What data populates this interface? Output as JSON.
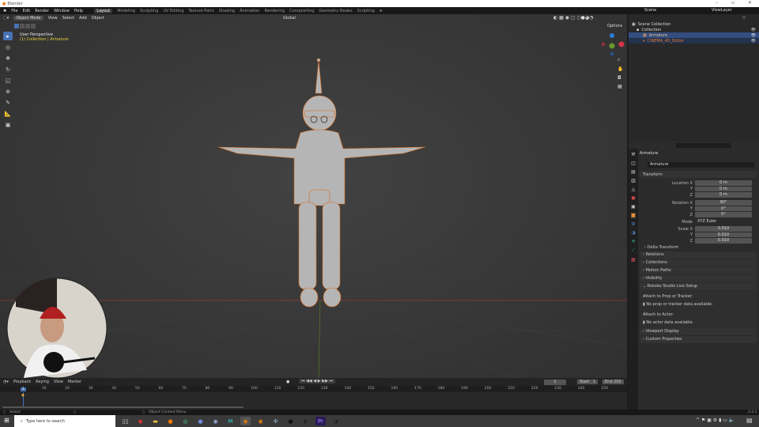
{
  "window": {
    "title": "Blender"
  },
  "menus": [
    "File",
    "Edit",
    "Render",
    "Window",
    "Help"
  ],
  "workspaces": [
    "Layout",
    "Modeling",
    "Sculpting",
    "UV Editing",
    "Texture Paint",
    "Shading",
    "Animation",
    "Rendering",
    "Compositing",
    "Geometry Nodes",
    "Scripting"
  ],
  "active_workspace": "Layout",
  "scene": "Scene",
  "view_layer": "ViewLayer",
  "viewport": {
    "mode": "Object Mode",
    "menus": [
      "View",
      "Select",
      "Add",
      "Object"
    ],
    "orientation": "Global",
    "options": "Options",
    "perspective": "User Perspective",
    "context": "(1) Collection | Armature"
  },
  "outliner": {
    "root": "Scene Collection",
    "collection": "Collection",
    "items": [
      "Armature",
      "CINEMA_4D_Editor"
    ]
  },
  "properties": {
    "object": "Armature",
    "data_name": "Armature",
    "transform": "Transform",
    "location": {
      "label": "Location X",
      "x": "0 m",
      "y": "0 m",
      "z": "0 m"
    },
    "rotation": {
      "label": "Rotation X",
      "x": "90°",
      "y": "0°",
      "z": "0°"
    },
    "mode_label": "Mode",
    "mode": "XYZ Euler",
    "scale": {
      "label": "Scale X",
      "x": "0.010",
      "y": "0.010",
      "z": "0.010"
    },
    "axis_y": "Y",
    "axis_z": "Z",
    "delta": "Delta Transform",
    "panels": [
      "Relations",
      "Collections",
      "Motion Paths",
      "Visibility"
    ],
    "rokoko": {
      "title": "Rokoko Studio Live Setup",
      "prop_label": "Attach to Prop or Tracker:",
      "prop_msg": "No prop or tracker data available.",
      "actor_label": "Attach to Actor:",
      "actor_msg": "No actor data available."
    },
    "panels2": [
      "Viewport Display",
      "Custom Properties"
    ]
  },
  "timeline": {
    "menus": [
      "Playback",
      "Keying",
      "View",
      "Marker"
    ],
    "current_frame": "1",
    "start_label": "Start",
    "start": "1",
    "end_label": "End",
    "end": "250",
    "ticks": [
      "10",
      "20",
      "30",
      "40",
      "50",
      "60",
      "70",
      "80",
      "90",
      "100",
      "110",
      "120",
      "130",
      "140",
      "150",
      "160",
      "170",
      "180",
      "190",
      "200",
      "210",
      "220",
      "230",
      "240",
      "250"
    ],
    "cursor": "1"
  },
  "status": {
    "left": "Select",
    "mid": "Object Context Menu",
    "version": "3.3.1"
  },
  "taskbar": {
    "search_placeholder": "Type here to search"
  }
}
